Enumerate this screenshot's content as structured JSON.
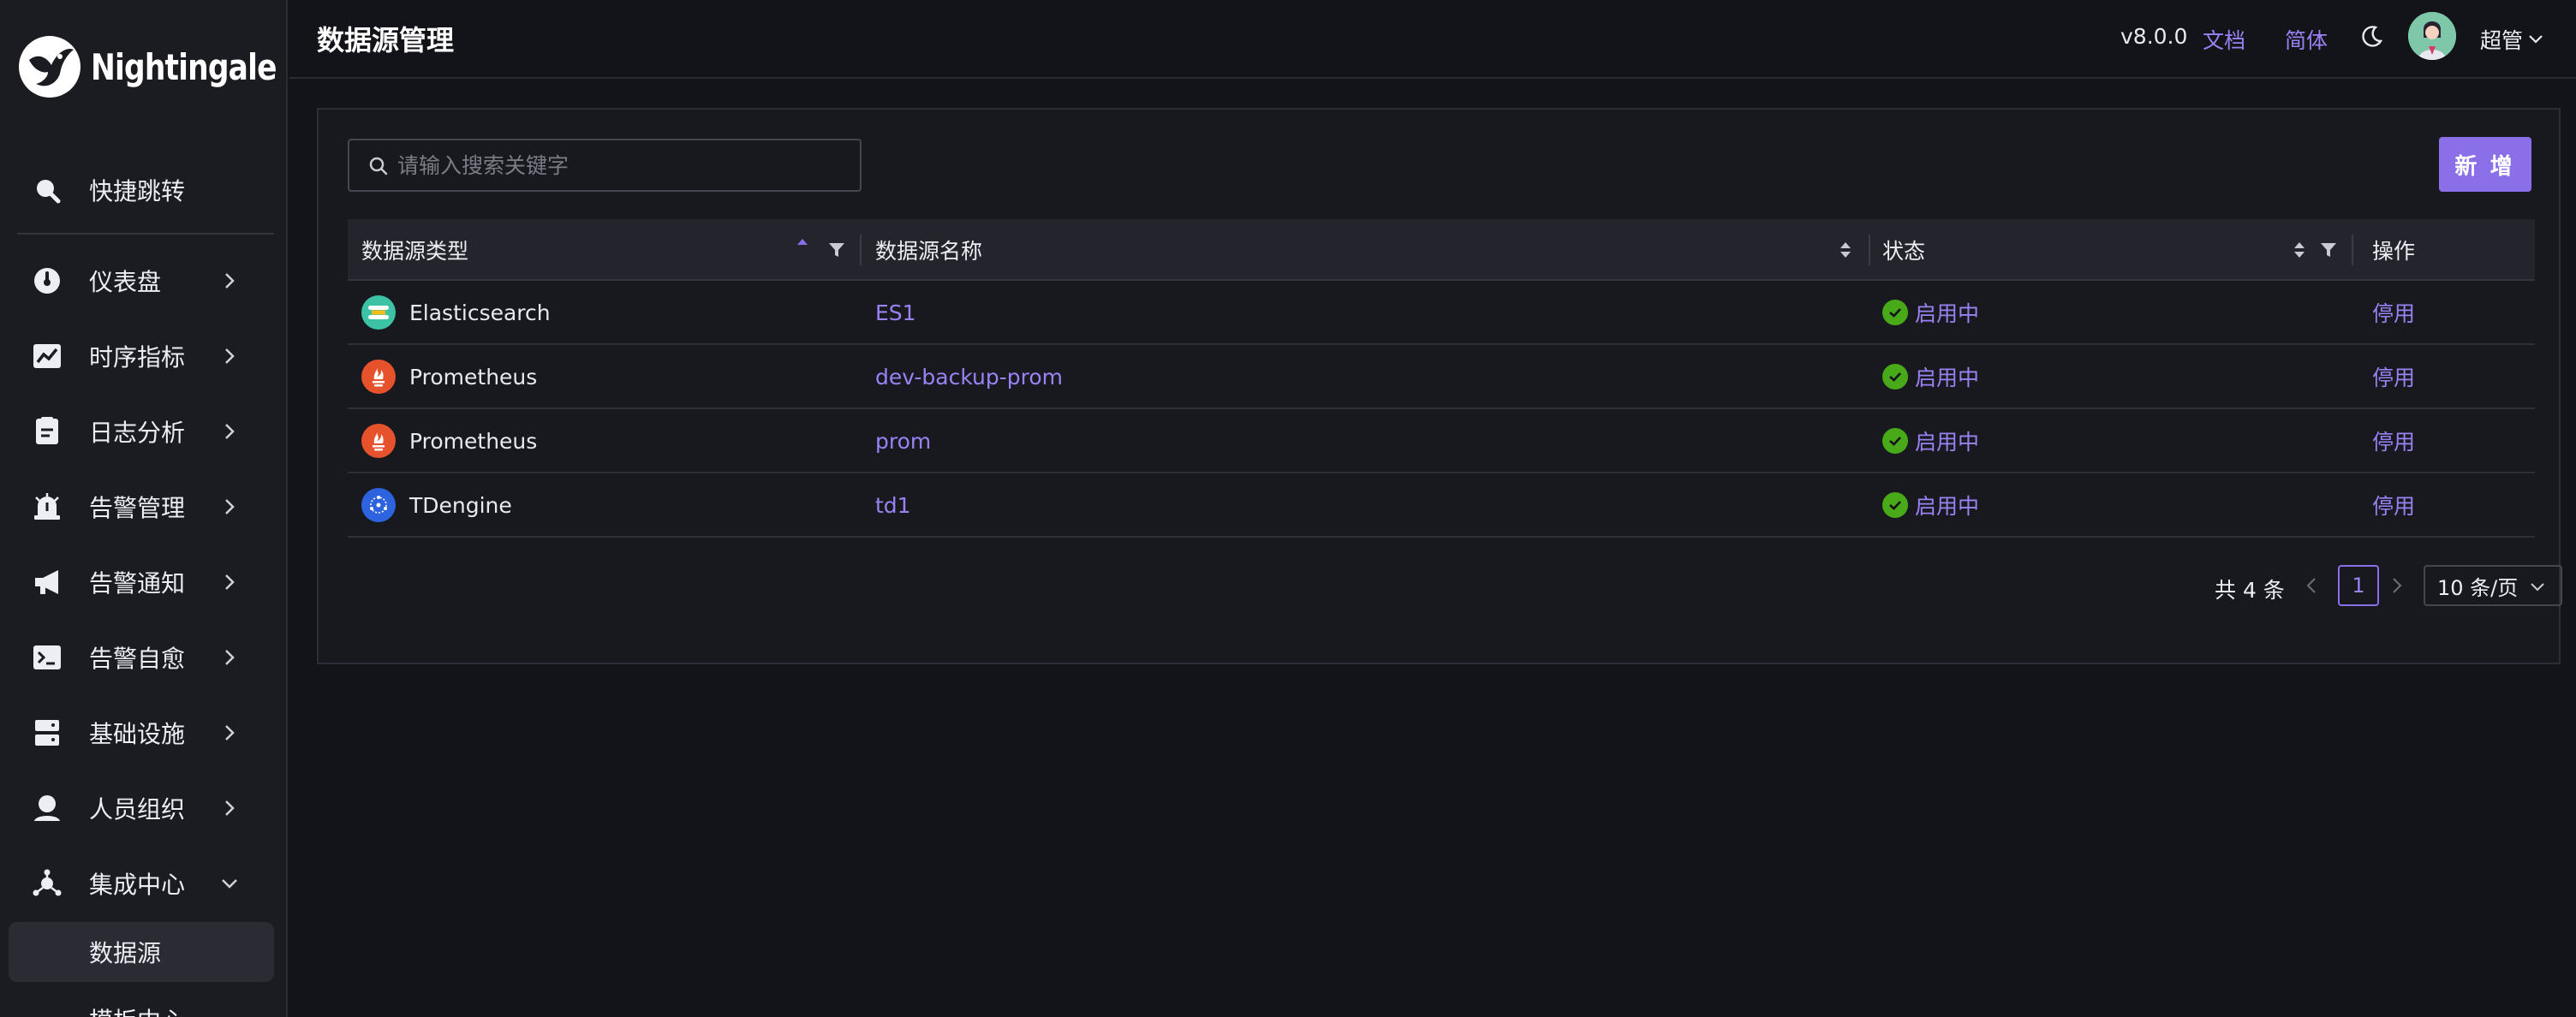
{
  "app": {
    "logo_text": "Nightingale",
    "page_title": "数据源管理"
  },
  "header": {
    "version": "v8.0.0",
    "docs_label": "文档",
    "lang_label": "简体",
    "user_name": "超管"
  },
  "sidebar": {
    "items": [
      {
        "label": "快捷跳转",
        "icon": "search-icon"
      },
      {
        "label": "仪表盘",
        "icon": "dashboard-icon"
      },
      {
        "label": "时序指标",
        "icon": "line-chart-icon"
      },
      {
        "label": "日志分析",
        "icon": "log-icon"
      },
      {
        "label": "告警管理",
        "icon": "alarm-icon"
      },
      {
        "label": "告警通知",
        "icon": "megaphone-icon"
      },
      {
        "label": "告警自愈",
        "icon": "terminal-icon"
      },
      {
        "label": "基础设施",
        "icon": "server-icon"
      },
      {
        "label": "人员组织",
        "icon": "user-icon"
      },
      {
        "label": "集成中心",
        "icon": "integration-icon"
      }
    ],
    "sub_items": [
      {
        "label": "数据源"
      },
      {
        "label": "模板中心"
      }
    ]
  },
  "toolbar": {
    "search_placeholder": "请输入搜索关键字",
    "add_label": "新 增"
  },
  "table": {
    "columns": [
      "数据源类型",
      "数据源名称",
      "状态",
      "操作"
    ],
    "rows": [
      {
        "type": "Elasticsearch",
        "type_icon": "elasticsearch-icon",
        "name": "ES1",
        "status": "启用中",
        "action": "停用"
      },
      {
        "type": "Prometheus",
        "type_icon": "prometheus-icon",
        "name": "dev-backup-prom",
        "status": "启用中",
        "action": "停用"
      },
      {
        "type": "Prometheus",
        "type_icon": "prometheus-icon",
        "name": "prom",
        "status": "启用中",
        "action": "停用"
      },
      {
        "type": "TDengine",
        "type_icon": "tdengine-icon",
        "name": "td1",
        "status": "启用中",
        "action": "停用"
      }
    ]
  },
  "pagination": {
    "total": "共 4 条",
    "current_page": "1",
    "page_size": "10 条/页"
  },
  "colors": {
    "accent": "#8b6fe8",
    "link": "#9a82f5",
    "success": "#49aa19",
    "background": "#131419",
    "sidebar": "#1b1c22"
  }
}
